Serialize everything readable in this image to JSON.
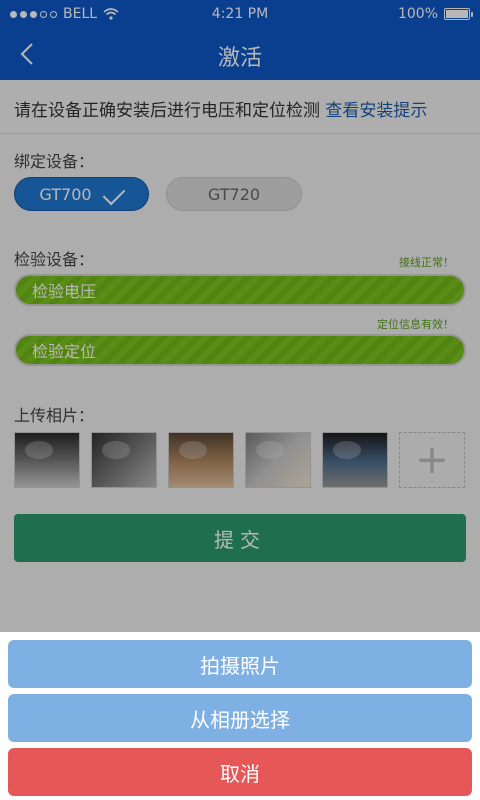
{
  "status_bar": {
    "carrier": "BELL",
    "time": "4:21 PM",
    "battery": "100%"
  },
  "nav": {
    "title": "激活"
  },
  "hint": {
    "text": "请在设备正确安装后进行电压和定位检测",
    "link": "查看安装提示"
  },
  "bind": {
    "label": "绑定设备：",
    "devices": [
      {
        "label": "GT700",
        "selected": true
      },
      {
        "label": "GT720",
        "selected": false
      }
    ]
  },
  "check": {
    "label": "检验设备：",
    "voltage": {
      "status": "接线正常！",
      "label": "检验电压"
    },
    "location": {
      "status": "定位信息有效！",
      "label": "检验定位"
    }
  },
  "upload": {
    "label": "上传相片：",
    "add_symbol": "+"
  },
  "submit": {
    "label": "提交"
  },
  "action_sheet": {
    "take_photo": "拍摄照片",
    "choose_album": "从相册选择",
    "cancel": "取消"
  },
  "colors": {
    "nav_bg": "#0f58c6",
    "selected_device": "#1f76d0",
    "check_bar": "#7cc41f",
    "submit": "#2b9a6e",
    "sheet_action": "#7fb0e3",
    "sheet_cancel": "#e65858"
  }
}
